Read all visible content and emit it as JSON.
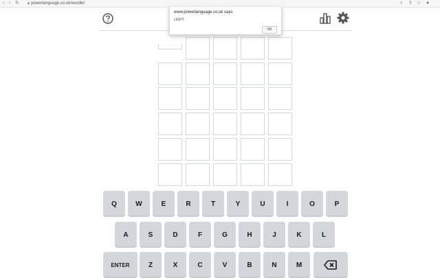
{
  "browser": {
    "url": "powerlanguage.co.uk/wordle/",
    "nav_icons": [
      "back-icon",
      "forward-icon",
      "reload-icon"
    ],
    "bar_icons": [
      "search-icon",
      "share-icon",
      "bookmark-star-icon",
      "profile-icon"
    ]
  },
  "header": {
    "help_icon": "help-circle-icon",
    "stats_icon": "stats-bars-icon",
    "settings_icon": "gear-icon"
  },
  "alert": {
    "title": "www.powerlanguage.co.uk says",
    "message": "LIGHT",
    "ok_label": "OK"
  },
  "board": {
    "rows": 6,
    "cols": 5,
    "cells": [
      [
        "",
        "",
        "",
        "",
        ""
      ],
      [
        "",
        "",
        "",
        "",
        ""
      ],
      [
        "",
        "",
        "",
        "",
        ""
      ],
      [
        "",
        "",
        "",
        "",
        ""
      ],
      [
        "",
        "",
        "",
        "",
        ""
      ],
      [
        "",
        "",
        "",
        "",
        ""
      ]
    ]
  },
  "keyboard": {
    "row1": [
      "Q",
      "W",
      "E",
      "R",
      "T",
      "Y",
      "U",
      "I",
      "O",
      "P"
    ],
    "row2": [
      "A",
      "S",
      "D",
      "F",
      "G",
      "H",
      "J",
      "K",
      "L"
    ],
    "row3": [
      "ENTER",
      "Z",
      "X",
      "C",
      "V",
      "B",
      "N",
      "M"
    ],
    "backspace_icon": "backspace-icon"
  },
  "colors": {
    "key_bg": "#d3d6da",
    "tile_border": "#d3d6da",
    "text": "#1a1a1b"
  }
}
